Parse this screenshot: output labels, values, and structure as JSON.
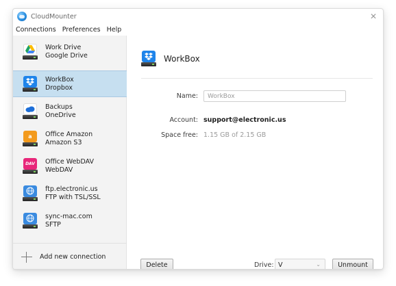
{
  "window": {
    "title": "CloudMounter",
    "close_glyph": "✕"
  },
  "menu": {
    "items": [
      "Connections",
      "Preferences",
      "Help"
    ]
  },
  "sidebar": {
    "items": [
      {
        "name": "Work Drive",
        "type": "Google Drive",
        "icon": "google-drive-icon",
        "color": "#ffffff",
        "selected": false
      },
      {
        "name": "WorkBox",
        "type": "Dropbox",
        "icon": "dropbox-icon",
        "color": "#1e84ea",
        "selected": true
      },
      {
        "name": "Backups",
        "type": "OneDrive",
        "icon": "onedrive-icon",
        "color": "#1c6ed8",
        "selected": false
      },
      {
        "name": "Office Amazon",
        "type": "Amazon S3",
        "icon": "amazon-s3-icon",
        "color": "#f39a1c",
        "selected": false
      },
      {
        "name": "Office WebDAV",
        "type": "WebDAV",
        "icon": "webdav-icon",
        "color": "#e8277a",
        "selected": false
      },
      {
        "name": "ftp.electronic.us",
        "type": "FTP with TSL/SSL",
        "icon": "ftp-globe-icon",
        "color": "#3a8be0",
        "selected": false
      },
      {
        "name": "sync-mac.com",
        "type": "SFTP",
        "icon": "sftp-globe-icon",
        "color": "#3a8be0",
        "selected": false
      }
    ],
    "add_label": "Add new connection"
  },
  "main": {
    "title": "WorkBox",
    "name_label": "Name:",
    "name_value": "WorkBox",
    "account_label": "Account:",
    "account_value": "support@electronic.us",
    "space_label": "Space free:",
    "space_value": "1.15 GB of 2.15 GB",
    "delete_label": "Delete",
    "drive_label": "Drive:",
    "drive_value": "V",
    "unmount_label": "Unmount"
  },
  "colors": {
    "selection": "#c6dff0",
    "sidebar_bg": "#f3f3f3"
  }
}
